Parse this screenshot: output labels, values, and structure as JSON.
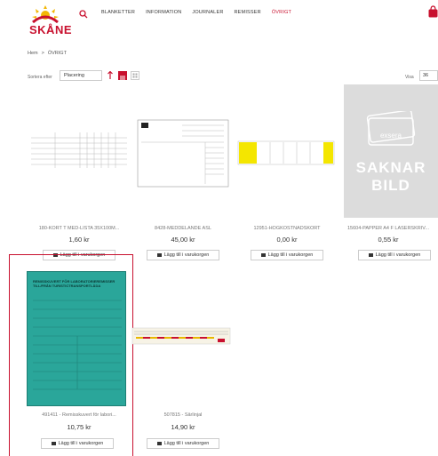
{
  "header": {
    "logo_text": "SKÅNE",
    "nav": [
      "BLANKETTER",
      "INFORMATION",
      "JOURNALER",
      "REMISSER",
      "ÖVRIGT"
    ]
  },
  "breadcrumb": {
    "home": "Hem",
    "sep": ">",
    "current": "ÖVRIGT"
  },
  "toolbar": {
    "sort_label": "Sortera efter",
    "sort_value": "Placering",
    "show_label": "Visa",
    "show_value": "36"
  },
  "colors": {
    "accent": "#c8102e",
    "placeholder_bg": "#dcdcdc",
    "teal": "#2aa69a"
  },
  "products": [
    {
      "name": "180-KORT T MED-LISTA 35X100M...",
      "price": "1,60 kr",
      "button": "Lägg till i varukorgen"
    },
    {
      "name": "8428-MEDDELANDE ASL",
      "price": "45,00 kr",
      "button": "Lägg till i varukorgen"
    },
    {
      "name": "12951-HÖGKOSTNADSKORT",
      "price": "0,00 kr",
      "button": "Lägg till i varukorgen"
    },
    {
      "name": "15604-PAPPER A4 F LASERSKRIV...",
      "price": "0,55 kr",
      "button": "Lägg till i varukorgen",
      "placeholder_brand": "exsera",
      "placeholder_text_1": "SAKNAR",
      "placeholder_text_2": "BILD"
    },
    {
      "name": "491411 - Remisskuvert för labori...",
      "price": "10,75 kr",
      "button": "Lägg till i varukorgen",
      "image_heading": "REMISSKUVERT FÖR LABORATORIEREMISSER TILL/FRÅN TURISTICTRANSPORTLÅDA"
    },
    {
      "name": "507815 - Sårlinjal",
      "price": "14,90 kr",
      "button": "Lägg till i varukorgen"
    }
  ]
}
